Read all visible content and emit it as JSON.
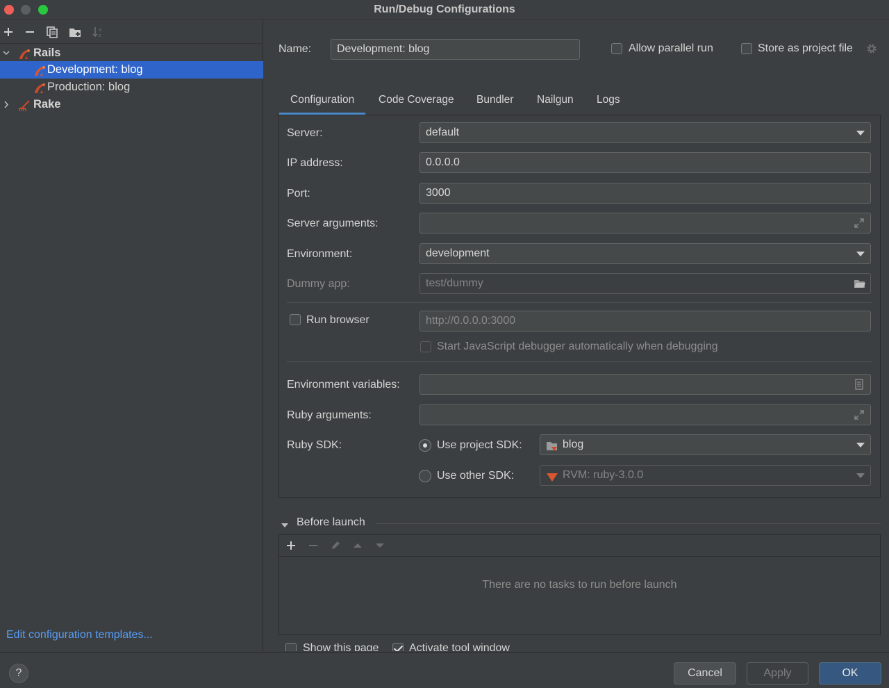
{
  "window": {
    "title": "Run/Debug Configurations"
  },
  "left_toolbar": {
    "icons": [
      "add-icon",
      "remove-icon",
      "copy-icon",
      "new-folder-icon",
      "sort-icon"
    ]
  },
  "tree": {
    "groups": [
      {
        "label": "Rails",
        "expanded": true,
        "icon": "rails-icon",
        "children": [
          {
            "label": "Development: blog",
            "selected": true,
            "icon": "rails-icon"
          },
          {
            "label": "Production: blog",
            "selected": false,
            "icon": "rails-icon"
          }
        ]
      },
      {
        "label": "Rake",
        "expanded": false,
        "icon": "rake-icon",
        "children": []
      }
    ]
  },
  "edit_templates_link": "Edit configuration templates...",
  "header": {
    "name_label": "Name:",
    "name_value": "Development: blog",
    "allow_parallel_label": "Allow parallel run",
    "allow_parallel_checked": false,
    "store_project_label": "Store as project file",
    "store_project_checked": false
  },
  "tabs": [
    "Configuration",
    "Code Coverage",
    "Bundler",
    "Nailgun",
    "Logs"
  ],
  "active_tab": "Configuration",
  "config": {
    "server_label": "Server:",
    "server_value": "default",
    "ip_label": "IP address:",
    "ip_value": "0.0.0.0",
    "port_label": "Port:",
    "port_value": "3000",
    "server_args_label": "Server arguments:",
    "server_args_value": "",
    "environment_label": "Environment:",
    "environment_value": "development",
    "dummy_app_label": "Dummy app:",
    "dummy_app_value": "test/dummy",
    "run_browser_label": "Run browser",
    "run_browser_checked": false,
    "run_browser_url": "http://0.0.0.0:3000",
    "js_debugger_label": "Start JavaScript debugger automatically when debugging",
    "js_debugger_checked": false,
    "env_vars_label": "Environment variables:",
    "env_vars_value": "",
    "ruby_args_label": "Ruby arguments:",
    "ruby_args_value": "",
    "ruby_sdk_label": "Ruby SDK:",
    "use_project_sdk_label": "Use project SDK:",
    "use_project_sdk_selected": true,
    "project_sdk_value": "blog",
    "use_other_sdk_label": "Use other SDK:",
    "use_other_sdk_selected": false,
    "other_sdk_value": "RVM: ruby-3.0.0"
  },
  "before_launch": {
    "title": "Before launch",
    "empty_text": "There are no tasks to run before launch",
    "toolbar_icons": [
      "add-icon",
      "remove-icon",
      "edit-icon",
      "move-up-icon",
      "move-down-icon"
    ]
  },
  "bottom_options": {
    "show_page_label": "Show this page",
    "show_page_checked": false,
    "activate_tool_label": "Activate tool window",
    "activate_tool_checked": true
  },
  "footer": {
    "help_label": "?",
    "cancel_label": "Cancel",
    "apply_label": "Apply",
    "ok_label": "OK"
  },
  "colors": {
    "background": "#3c3f41",
    "selection": "#2f65ca",
    "link": "#589df6",
    "primary_button": "#365880",
    "rails_red": "#cc4a2a"
  }
}
